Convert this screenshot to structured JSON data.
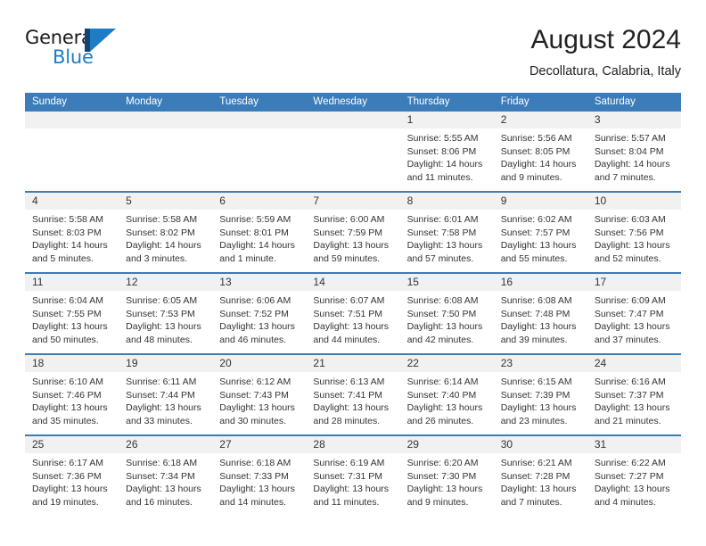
{
  "brand": {
    "name_part1": "General",
    "name_part2": "Blue",
    "accent_color": "#1d7cc4",
    "dark_color": "#12456f"
  },
  "header": {
    "title": "August 2024",
    "subtitle": "Decollatura, Calabria, Italy"
  },
  "calendar": {
    "header_bg": "#3b7cb9",
    "daynum_bg": "#f1f1f1",
    "weekdays": [
      "Sunday",
      "Monday",
      "Tuesday",
      "Wednesday",
      "Thursday",
      "Friday",
      "Saturday"
    ],
    "weeks": [
      [
        {
          "day": "",
          "lines": []
        },
        {
          "day": "",
          "lines": []
        },
        {
          "day": "",
          "lines": []
        },
        {
          "day": "",
          "lines": []
        },
        {
          "day": "1",
          "lines": [
            "Sunrise: 5:55 AM",
            "Sunset: 8:06 PM",
            "Daylight: 14 hours",
            "and 11 minutes."
          ]
        },
        {
          "day": "2",
          "lines": [
            "Sunrise: 5:56 AM",
            "Sunset: 8:05 PM",
            "Daylight: 14 hours",
            "and 9 minutes."
          ]
        },
        {
          "day": "3",
          "lines": [
            "Sunrise: 5:57 AM",
            "Sunset: 8:04 PM",
            "Daylight: 14 hours",
            "and 7 minutes."
          ]
        }
      ],
      [
        {
          "day": "4",
          "lines": [
            "Sunrise: 5:58 AM",
            "Sunset: 8:03 PM",
            "Daylight: 14 hours",
            "and 5 minutes."
          ]
        },
        {
          "day": "5",
          "lines": [
            "Sunrise: 5:58 AM",
            "Sunset: 8:02 PM",
            "Daylight: 14 hours",
            "and 3 minutes."
          ]
        },
        {
          "day": "6",
          "lines": [
            "Sunrise: 5:59 AM",
            "Sunset: 8:01 PM",
            "Daylight: 14 hours",
            "and 1 minute."
          ]
        },
        {
          "day": "7",
          "lines": [
            "Sunrise: 6:00 AM",
            "Sunset: 7:59 PM",
            "Daylight: 13 hours",
            "and 59 minutes."
          ]
        },
        {
          "day": "8",
          "lines": [
            "Sunrise: 6:01 AM",
            "Sunset: 7:58 PM",
            "Daylight: 13 hours",
            "and 57 minutes."
          ]
        },
        {
          "day": "9",
          "lines": [
            "Sunrise: 6:02 AM",
            "Sunset: 7:57 PM",
            "Daylight: 13 hours",
            "and 55 minutes."
          ]
        },
        {
          "day": "10",
          "lines": [
            "Sunrise: 6:03 AM",
            "Sunset: 7:56 PM",
            "Daylight: 13 hours",
            "and 52 minutes."
          ]
        }
      ],
      [
        {
          "day": "11",
          "lines": [
            "Sunrise: 6:04 AM",
            "Sunset: 7:55 PM",
            "Daylight: 13 hours",
            "and 50 minutes."
          ]
        },
        {
          "day": "12",
          "lines": [
            "Sunrise: 6:05 AM",
            "Sunset: 7:53 PM",
            "Daylight: 13 hours",
            "and 48 minutes."
          ]
        },
        {
          "day": "13",
          "lines": [
            "Sunrise: 6:06 AM",
            "Sunset: 7:52 PM",
            "Daylight: 13 hours",
            "and 46 minutes."
          ]
        },
        {
          "day": "14",
          "lines": [
            "Sunrise: 6:07 AM",
            "Sunset: 7:51 PM",
            "Daylight: 13 hours",
            "and 44 minutes."
          ]
        },
        {
          "day": "15",
          "lines": [
            "Sunrise: 6:08 AM",
            "Sunset: 7:50 PM",
            "Daylight: 13 hours",
            "and 42 minutes."
          ]
        },
        {
          "day": "16",
          "lines": [
            "Sunrise: 6:08 AM",
            "Sunset: 7:48 PM",
            "Daylight: 13 hours",
            "and 39 minutes."
          ]
        },
        {
          "day": "17",
          "lines": [
            "Sunrise: 6:09 AM",
            "Sunset: 7:47 PM",
            "Daylight: 13 hours",
            "and 37 minutes."
          ]
        }
      ],
      [
        {
          "day": "18",
          "lines": [
            "Sunrise: 6:10 AM",
            "Sunset: 7:46 PM",
            "Daylight: 13 hours",
            "and 35 minutes."
          ]
        },
        {
          "day": "19",
          "lines": [
            "Sunrise: 6:11 AM",
            "Sunset: 7:44 PM",
            "Daylight: 13 hours",
            "and 33 minutes."
          ]
        },
        {
          "day": "20",
          "lines": [
            "Sunrise: 6:12 AM",
            "Sunset: 7:43 PM",
            "Daylight: 13 hours",
            "and 30 minutes."
          ]
        },
        {
          "day": "21",
          "lines": [
            "Sunrise: 6:13 AM",
            "Sunset: 7:41 PM",
            "Daylight: 13 hours",
            "and 28 minutes."
          ]
        },
        {
          "day": "22",
          "lines": [
            "Sunrise: 6:14 AM",
            "Sunset: 7:40 PM",
            "Daylight: 13 hours",
            "and 26 minutes."
          ]
        },
        {
          "day": "23",
          "lines": [
            "Sunrise: 6:15 AM",
            "Sunset: 7:39 PM",
            "Daylight: 13 hours",
            "and 23 minutes."
          ]
        },
        {
          "day": "24",
          "lines": [
            "Sunrise: 6:16 AM",
            "Sunset: 7:37 PM",
            "Daylight: 13 hours",
            "and 21 minutes."
          ]
        }
      ],
      [
        {
          "day": "25",
          "lines": [
            "Sunrise: 6:17 AM",
            "Sunset: 7:36 PM",
            "Daylight: 13 hours",
            "and 19 minutes."
          ]
        },
        {
          "day": "26",
          "lines": [
            "Sunrise: 6:18 AM",
            "Sunset: 7:34 PM",
            "Daylight: 13 hours",
            "and 16 minutes."
          ]
        },
        {
          "day": "27",
          "lines": [
            "Sunrise: 6:18 AM",
            "Sunset: 7:33 PM",
            "Daylight: 13 hours",
            "and 14 minutes."
          ]
        },
        {
          "day": "28",
          "lines": [
            "Sunrise: 6:19 AM",
            "Sunset: 7:31 PM",
            "Daylight: 13 hours",
            "and 11 minutes."
          ]
        },
        {
          "day": "29",
          "lines": [
            "Sunrise: 6:20 AM",
            "Sunset: 7:30 PM",
            "Daylight: 13 hours",
            "and 9 minutes."
          ]
        },
        {
          "day": "30",
          "lines": [
            "Sunrise: 6:21 AM",
            "Sunset: 7:28 PM",
            "Daylight: 13 hours",
            "and 7 minutes."
          ]
        },
        {
          "day": "31",
          "lines": [
            "Sunrise: 6:22 AM",
            "Sunset: 7:27 PM",
            "Daylight: 13 hours",
            "and 4 minutes."
          ]
        }
      ]
    ]
  }
}
